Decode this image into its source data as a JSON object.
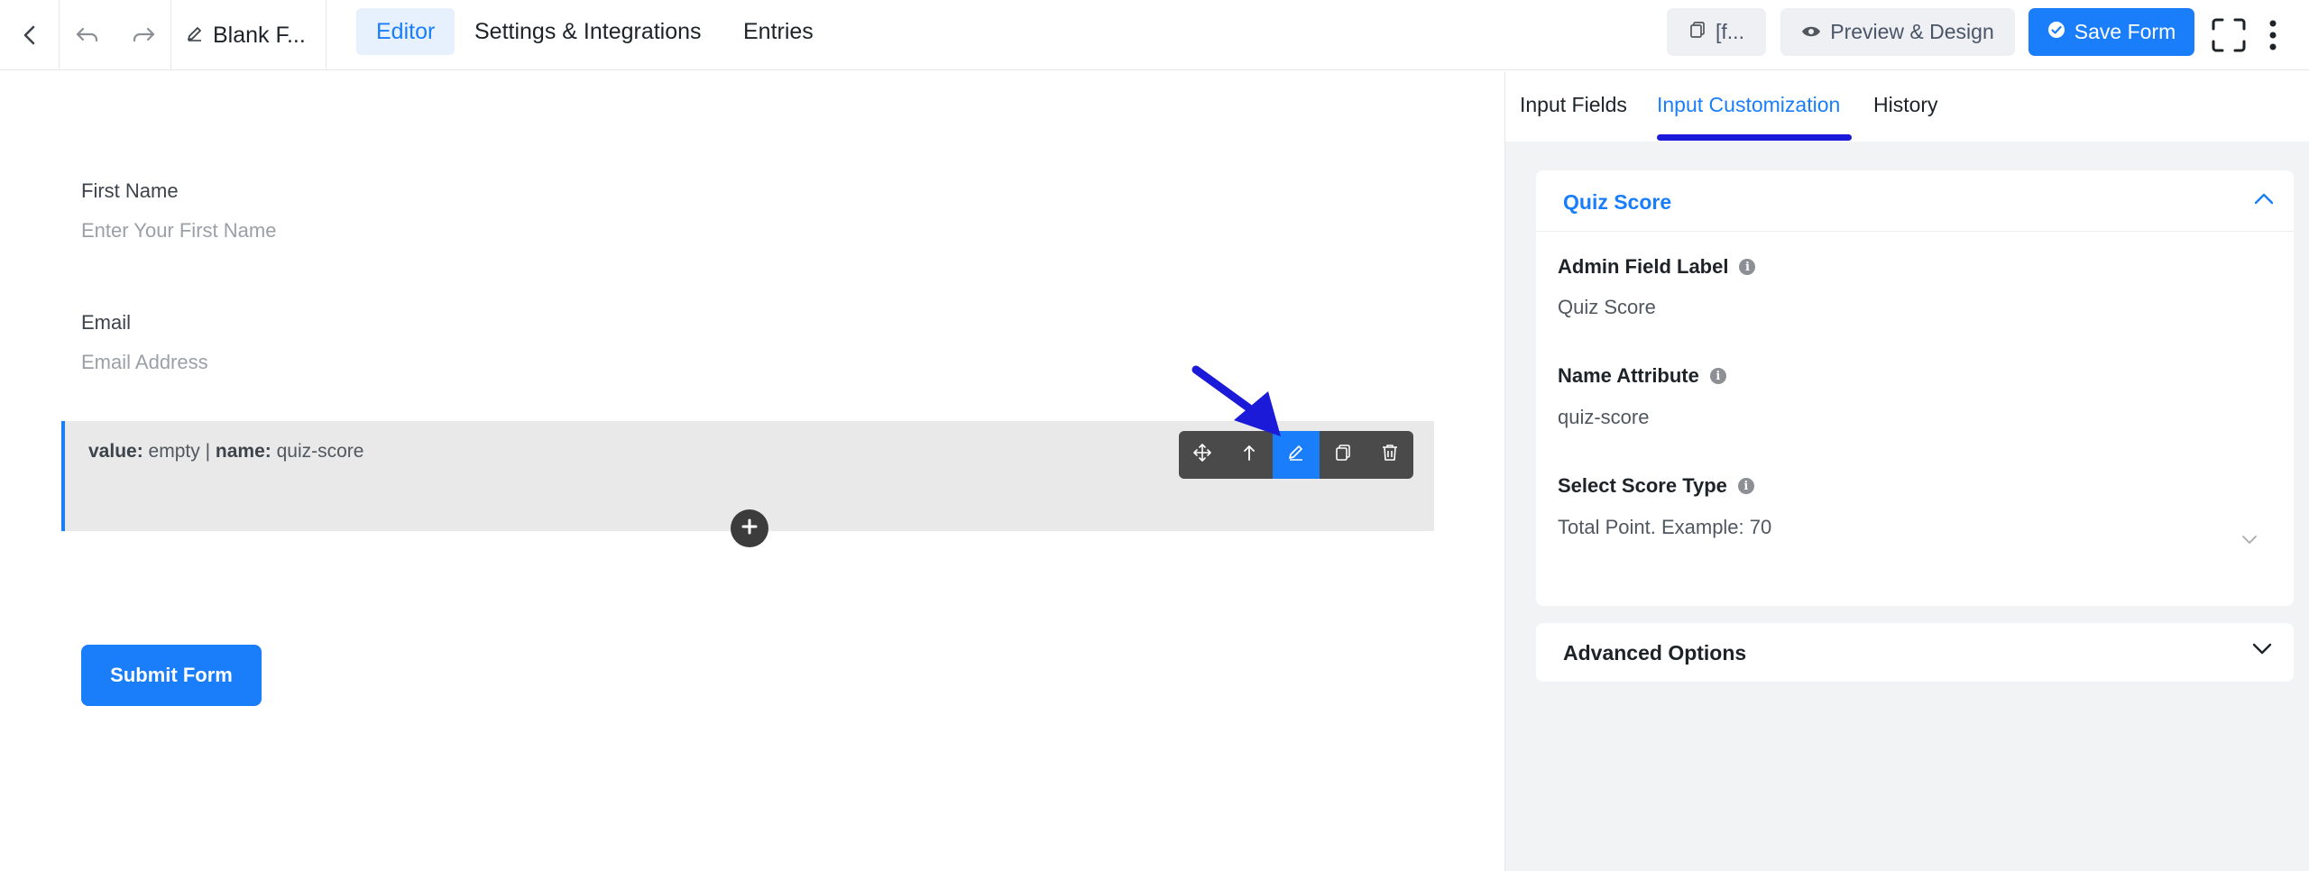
{
  "topbar": {
    "form_title": "Blank F...",
    "tabs": [
      {
        "label": "Editor",
        "active": true
      },
      {
        "label": "Settings & Integrations",
        "active": false
      },
      {
        "label": "Entries",
        "active": false
      }
    ],
    "shortcode_label": "[f...",
    "preview_label": "Preview & Design",
    "save_label": "Save Form",
    "icons": [
      "back-icon",
      "undo-icon",
      "redo-icon",
      "pencil-icon",
      "copy-icon",
      "eye-icon",
      "check-circle-icon",
      "fullscreen-icon",
      "more-vertical-icon"
    ]
  },
  "editor": {
    "fields": [
      {
        "label": "First Name",
        "placeholder": "Enter Your First Name"
      },
      {
        "label": "Email",
        "placeholder": "Email Address"
      }
    ],
    "selected_field": {
      "value_key": "value:",
      "value_text": "empty",
      "separator": "|",
      "name_key": "name:",
      "name_text": "quiz-score"
    },
    "toolbar_icons": [
      "move-icon",
      "arrow-up-icon",
      "edit-icon",
      "duplicate-icon",
      "trash-icon"
    ],
    "active_tool": "edit-icon",
    "submit_label": "Submit Form",
    "annotation_color": "#1a1ad8"
  },
  "sidebar": {
    "tabs": [
      {
        "label": "Input Fields",
        "active": false
      },
      {
        "label": "Input Customization",
        "active": true
      },
      {
        "label": "History",
        "active": false
      }
    ],
    "panel_title": "Quiz Score",
    "settings": [
      {
        "label": "Admin Field Label",
        "value": "Quiz Score"
      },
      {
        "label": "Name Attribute",
        "value": "quiz-score"
      },
      {
        "label": "Select Score Type",
        "value": "Total Point. Example: 70"
      }
    ],
    "advanced_label": "Advanced Options"
  },
  "colors": {
    "accent": "#1a7efb",
    "annotation": "#1a1ad8",
    "toolbar_bg": "#4a4a4a"
  }
}
